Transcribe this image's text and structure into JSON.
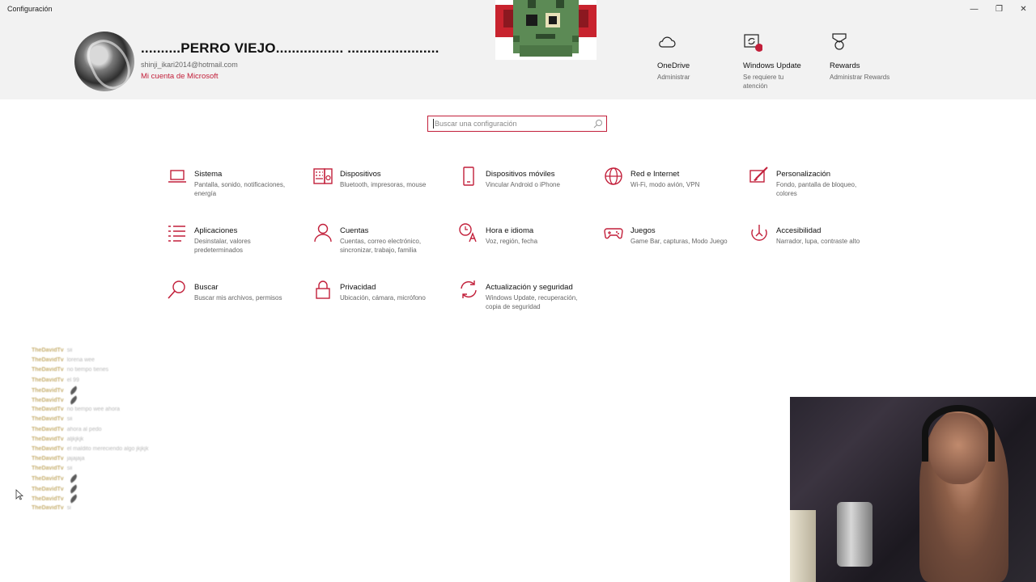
{
  "window": {
    "title": "Configuración",
    "controls": [
      "—",
      "❐",
      "✕"
    ]
  },
  "profile": {
    "name": "..........PERRO VIEJO................. .......................",
    "email": "shinji_ikari2014@hotmail.com",
    "account_link": "Mi cuenta de Microsoft"
  },
  "quick_links": [
    {
      "title": "OneDrive",
      "subtitle": "Administrar",
      "icon": "cloud-icon"
    },
    {
      "title": "Windows Update",
      "subtitle": "Se requiere tu atención",
      "icon": "windows-update-icon"
    },
    {
      "title": "Rewards",
      "subtitle": "Administrar Rewards",
      "icon": "rewards-icon"
    }
  ],
  "search": {
    "placeholder": "Buscar una configuración"
  },
  "categories": [
    {
      "title": "Sistema",
      "subtitle": "Pantalla, sonido, notificaciones, energía",
      "icon": "laptop-icon"
    },
    {
      "title": "Dispositivos",
      "subtitle": "Bluetooth, impresoras, mouse",
      "icon": "keyboard-speaker-icon"
    },
    {
      "title": "Dispositivos móviles",
      "subtitle": "Vincular Android o iPhone",
      "icon": "phone-icon"
    },
    {
      "title": "Red e Internet",
      "subtitle": "Wi-Fi, modo avión, VPN",
      "icon": "globe-icon"
    },
    {
      "title": "Personalización",
      "subtitle": "Fondo, pantalla de bloqueo, colores",
      "icon": "paint-brush-icon"
    },
    {
      "title": "Aplicaciones",
      "subtitle": "Desinstalar, valores predeterminados",
      "icon": "apps-list-icon"
    },
    {
      "title": "Cuentas",
      "subtitle": "Cuentas, correo electrónico, sincronizar, trabajo, familia",
      "icon": "person-icon"
    },
    {
      "title": "Hora e idioma",
      "subtitle": "Voz, región, fecha",
      "icon": "time-language-icon"
    },
    {
      "title": "Juegos",
      "subtitle": "Game Bar, capturas, Modo Juego",
      "icon": "gamepad-icon"
    },
    {
      "title": "Accesibilidad",
      "subtitle": "Narrador, lupa, contraste alto",
      "icon": "accessibility-icon"
    },
    {
      "title": "Buscar",
      "subtitle": "Buscar mis archivos, permisos",
      "icon": "search-icon"
    },
    {
      "title": "Privacidad",
      "subtitle": "Ubicación, cámara, micrófono",
      "icon": "lock-icon"
    },
    {
      "title": "Actualización y seguridad",
      "subtitle": "Windows Update, recuperación, copia de seguridad",
      "icon": "sync-icon"
    }
  ],
  "chat": {
    "lines": [
      {
        "user": "TheDavidTv",
        "msg": "sii"
      },
      {
        "user": "TheDavidTv",
        "msg": "lorena wee"
      },
      {
        "user": "TheDavidTv",
        "msg": "no tiempo tienes"
      },
      {
        "user": "TheDavidTv",
        "msg": "el 99"
      },
      {
        "user": "TheDavidTv",
        "msg": "",
        "emote": true
      },
      {
        "user": "TheDavidTv",
        "msg": "",
        "emote": true
      },
      {
        "user": "TheDavidTv",
        "msg": "no tiempo wee ahora"
      },
      {
        "user": "TheDavidTv",
        "msg": "sii"
      },
      {
        "user": "TheDavidTv",
        "msg": "ahora al pedo"
      },
      {
        "user": "TheDavidTv",
        "msg": "aljkjkjk"
      },
      {
        "user": "TheDavidTv",
        "msg": "el maldito mereciendo algo jkjkjk"
      },
      {
        "user": "TheDavidTv",
        "msg": "jajajaja"
      },
      {
        "user": "TheDavidTv",
        "msg": "sii"
      },
      {
        "user": "TheDavidTv",
        "msg": "",
        "emote": true
      },
      {
        "user": "TheDavidTv",
        "msg": "",
        "emote": true
      },
      {
        "user": "TheDavidTv",
        "msg": "",
        "emote": true
      },
      {
        "user": "TheDavidTv",
        "msg": "si"
      }
    ]
  },
  "colors": {
    "accent": "#c21f3a",
    "header_bg": "#f2f2f2"
  }
}
